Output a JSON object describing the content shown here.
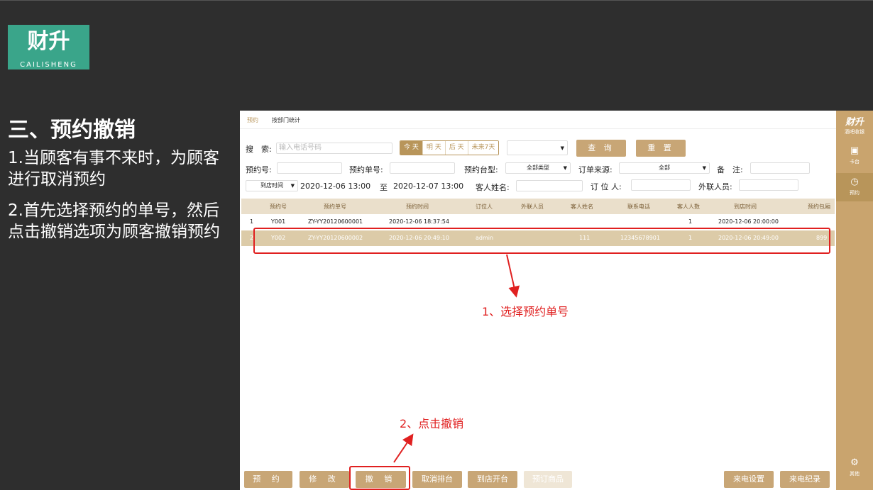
{
  "logo": {
    "main": "财升",
    "sub": "CAILISHENG"
  },
  "slide": {
    "title": "三、预约撤销",
    "step1": "1.当顾客有事不来时，为顾客进行取消预约",
    "step2": "2.首先选择预约的单号，然后点击撤销选项为顾客撤销预约"
  },
  "app": {
    "tabs": [
      "预约",
      "按部门统计"
    ],
    "search": {
      "label": "搜　索:",
      "placeholder": "输入电话号码",
      "date_filters": [
        "今 天",
        "明 天",
        "后 天",
        "未来7天"
      ],
      "query_button": "查 询",
      "reset_button": "重 置"
    },
    "filters": {
      "booking_no_label": "预约号:",
      "order_no_label": "预约单号:",
      "table_type_label": "预约台型:",
      "table_type_value": "全部类型",
      "source_label": "订单来源:",
      "source_value": "全部",
      "note_label": "备　注:",
      "time_type_value": "到店时间",
      "start_time": "2020-12-06 13:00",
      "to_label": "至",
      "end_time": "2020-12-07 13:00",
      "guest_name_label": "客人姓名:",
      "booker_label": "订 位 人:",
      "liaison_label": "外联人员:"
    },
    "table": {
      "headers": [
        "预约号",
        "预约单号",
        "预约时间",
        "订位人",
        "外联人员",
        "客人姓名",
        "联系电话",
        "客人人数",
        "到店时间",
        "预约包厢"
      ],
      "rows": [
        {
          "idx": "1",
          "no": "Y001",
          "order": "ZY-YY20120600001",
          "time": "2020-12-06 18:37:54",
          "booker": "",
          "liaison": "",
          "guest": "",
          "phone": "",
          "count": "1",
          "arrive": "2020-12-06 20:00:00",
          "room": ""
        },
        {
          "idx": "2",
          "no": "Y002",
          "order": "ZY-YY20120600002",
          "time": "2020-12-06 20:49:10",
          "booker": "admin",
          "liaison": "",
          "guest": "111",
          "phone": "12345678901",
          "count": "1",
          "arrive": "2020-12-06 20:49:00",
          "room": "899"
        }
      ]
    },
    "buttons": {
      "reserve": "预 约",
      "edit": "修 改",
      "cancel": "撤 销",
      "cancel_queue": "取消排台",
      "open_table": "到店开台",
      "order_goods": "预订商品",
      "call_settings": "来电设置",
      "call_log": "来电纪录"
    }
  },
  "annotations": {
    "step1": "1、选择预约单号",
    "step2": "2、点击撤销"
  },
  "sidebar": {
    "brand": "财升",
    "brand_sub": "酒吧收银",
    "items": [
      {
        "label": "卡台",
        "icon": "card-table-icon"
      },
      {
        "label": "预约",
        "icon": "clock-icon"
      },
      {
        "label": "其他",
        "icon": "gear-icon"
      }
    ]
  },
  "colors": {
    "accent": "#c8a676",
    "annotation": "#e02020",
    "logo": "#3aa58a",
    "background": "#2e2e2e"
  }
}
